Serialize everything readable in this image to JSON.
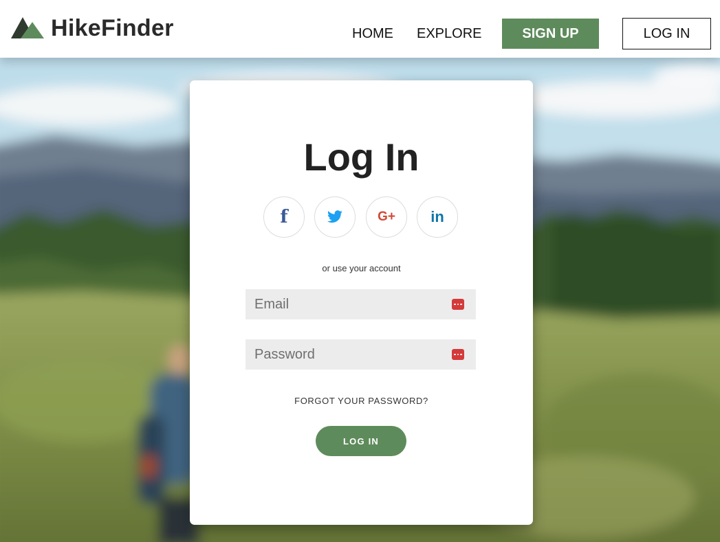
{
  "brand": {
    "name": "HikeFinder",
    "logo_colors": {
      "dark": "#2f3b2e",
      "green": "#5e8b5b"
    }
  },
  "nav": {
    "home": "HOME",
    "explore": "EXPLORE",
    "signup": "SIGN UP",
    "login": "LOG IN"
  },
  "login_card": {
    "title": "Log In",
    "social": [
      {
        "icon": "facebook-icon",
        "glyph": "f",
        "color": "#3b5998"
      },
      {
        "icon": "twitter-icon",
        "glyph": "",
        "color": "#1da1f2"
      },
      {
        "icon": "google-plus-icon",
        "glyph": "G+",
        "color": "#d34836"
      },
      {
        "icon": "linkedin-icon",
        "glyph": "in",
        "color": "#0e76a8"
      }
    ],
    "alt_text": "or use your account",
    "email_placeholder": "Email",
    "password_placeholder": "Password",
    "forgot": "FORGOT YOUR PASSWORD?",
    "submit": "LOG IN"
  },
  "colors": {
    "accent": "#5e8b5b",
    "field_bg": "#ececec",
    "autofill_icon": "#d43a3a"
  }
}
